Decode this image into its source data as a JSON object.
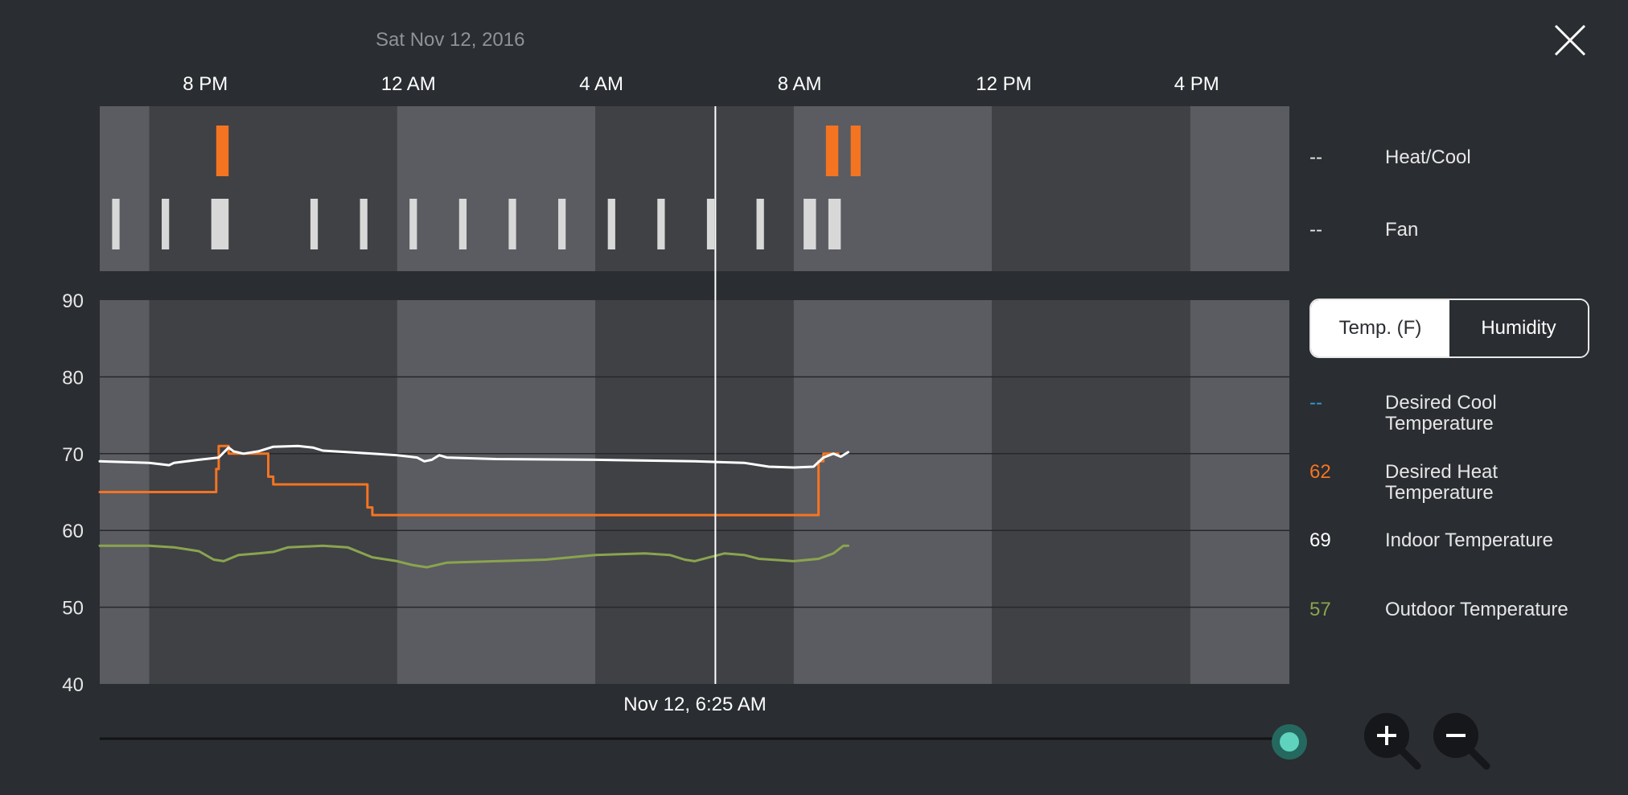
{
  "header": {
    "date": "Sat Nov 12, 2016",
    "time_labels": [
      "8 PM",
      "12 AM",
      "4 AM",
      "8 AM",
      "12 PM",
      "4 PM"
    ]
  },
  "colors": {
    "heat": "#f57421",
    "fan": "#d8d8d8",
    "indoor": "#ffffff",
    "outdoor": "#8aa44f",
    "cool": "#2f9bd6",
    "accent_knob": "#5fd3bd"
  },
  "activity_legend": {
    "heat_cool": {
      "value": "--",
      "label": "Heat/Cool"
    },
    "fan": {
      "value": "--",
      "label": "Fan"
    }
  },
  "toggle": {
    "temp_label": "Temp. (F)",
    "humidity_label": "Humidity"
  },
  "temp_legend": {
    "desired_cool": {
      "value": "--",
      "label": "Desired Cool Temperature"
    },
    "desired_heat": {
      "value": "62",
      "label": "Desired Heat Temperature"
    },
    "indoor": {
      "value": "69",
      "label": "Indoor Temperature"
    },
    "outdoor": {
      "value": "57",
      "label": "Outdoor Temperature"
    }
  },
  "cursor": {
    "time": "Nov 12, 6:25 AM"
  },
  "zoom": {
    "in_icon": "zoom-in-icon",
    "out_icon": "zoom-out-icon"
  },
  "chart_data": {
    "type": "line",
    "x_unit": "hours since 6:00 PM Nov 11, 2016",
    "x_range": [
      0,
      24
    ],
    "ylim": [
      40,
      90
    ],
    "yticks": [
      90,
      80,
      70,
      60,
      50,
      40
    ],
    "xtick_labels": [
      "8 PM",
      "12 AM",
      "4 AM",
      "8 AM",
      "12 PM",
      "4 PM"
    ],
    "xticks": [
      2,
      6,
      10,
      14,
      18,
      22
    ],
    "cursor_x": 12.42,
    "heat_events": [
      [
        2.35,
        2.6
      ],
      [
        14.65,
        14.9
      ],
      [
        15.15,
        15.35
      ]
    ],
    "fan_events": [
      [
        0.25,
        0.4
      ],
      [
        1.25,
        1.4
      ],
      [
        2.25,
        2.6
      ],
      [
        4.25,
        4.4
      ],
      [
        5.25,
        5.4
      ],
      [
        6.25,
        6.4
      ],
      [
        7.25,
        7.4
      ],
      [
        8.25,
        8.4
      ],
      [
        9.25,
        9.4
      ],
      [
        10.25,
        10.4
      ],
      [
        11.25,
        11.4
      ],
      [
        12.25,
        12.4
      ],
      [
        13.25,
        13.4
      ],
      [
        14.2,
        14.45
      ],
      [
        14.7,
        14.95
      ]
    ],
    "series": [
      {
        "name": "Desired Heat Temperature",
        "key": "heat",
        "step": true,
        "points": [
          [
            0,
            65
          ],
          [
            2.35,
            65
          ],
          [
            2.35,
            68
          ],
          [
            2.4,
            68
          ],
          [
            2.4,
            71
          ],
          [
            2.6,
            71
          ],
          [
            2.6,
            70
          ],
          [
            3.4,
            70
          ],
          [
            3.4,
            67
          ],
          [
            3.5,
            67
          ],
          [
            3.5,
            66
          ],
          [
            5.4,
            66
          ],
          [
            5.4,
            63
          ],
          [
            5.5,
            63
          ],
          [
            5.5,
            62
          ],
          [
            14.5,
            62
          ],
          [
            14.5,
            69
          ],
          [
            14.6,
            69
          ],
          [
            14.6,
            70
          ],
          [
            14.9,
            70
          ]
        ]
      },
      {
        "name": "Indoor Temperature",
        "key": "indoor",
        "points": [
          [
            0,
            69
          ],
          [
            1.0,
            68.8
          ],
          [
            1.4,
            68.5
          ],
          [
            1.5,
            68.8
          ],
          [
            2.0,
            69.2
          ],
          [
            2.4,
            69.5
          ],
          [
            2.6,
            70.8
          ],
          [
            2.7,
            70.3
          ],
          [
            2.9,
            70.0
          ],
          [
            3.2,
            70.3
          ],
          [
            3.5,
            70.9
          ],
          [
            4.0,
            71.0
          ],
          [
            4.3,
            70.8
          ],
          [
            4.5,
            70.4
          ],
          [
            5.5,
            70.0
          ],
          [
            6.0,
            69.8
          ],
          [
            6.4,
            69.5
          ],
          [
            6.55,
            69.0
          ],
          [
            6.7,
            69.2
          ],
          [
            6.85,
            69.8
          ],
          [
            7.0,
            69.5
          ],
          [
            8.0,
            69.3
          ],
          [
            10.0,
            69.2
          ],
          [
            12.0,
            69.0
          ],
          [
            13.0,
            68.8
          ],
          [
            13.5,
            68.3
          ],
          [
            14.0,
            68.2
          ],
          [
            14.4,
            68.3
          ],
          [
            14.6,
            69.5
          ],
          [
            14.8,
            70.0
          ],
          [
            14.95,
            69.6
          ],
          [
            15.1,
            70.2
          ]
        ]
      },
      {
        "name": "Outdoor Temperature",
        "key": "outdoor",
        "points": [
          [
            0,
            58
          ],
          [
            1.0,
            58
          ],
          [
            1.5,
            57.8
          ],
          [
            2.0,
            57.3
          ],
          [
            2.3,
            56.2
          ],
          [
            2.5,
            56.0
          ],
          [
            2.8,
            56.8
          ],
          [
            3.2,
            57.0
          ],
          [
            3.5,
            57.2
          ],
          [
            3.8,
            57.8
          ],
          [
            4.5,
            58.0
          ],
          [
            5.0,
            57.8
          ],
          [
            5.5,
            56.5
          ],
          [
            6.0,
            56.0
          ],
          [
            6.3,
            55.5
          ],
          [
            6.6,
            55.2
          ],
          [
            7.0,
            55.8
          ],
          [
            8.0,
            56.0
          ],
          [
            9.0,
            56.2
          ],
          [
            9.5,
            56.5
          ],
          [
            10.0,
            56.8
          ],
          [
            11.0,
            57.0
          ],
          [
            11.5,
            56.8
          ],
          [
            11.8,
            56.2
          ],
          [
            12.0,
            56.0
          ],
          [
            12.3,
            56.5
          ],
          [
            12.6,
            57.0
          ],
          [
            13.0,
            56.8
          ],
          [
            13.3,
            56.3
          ],
          [
            14.0,
            56.0
          ],
          [
            14.5,
            56.3
          ],
          [
            14.8,
            57.0
          ],
          [
            15.0,
            58.0
          ],
          [
            15.1,
            58.0
          ]
        ]
      }
    ]
  }
}
